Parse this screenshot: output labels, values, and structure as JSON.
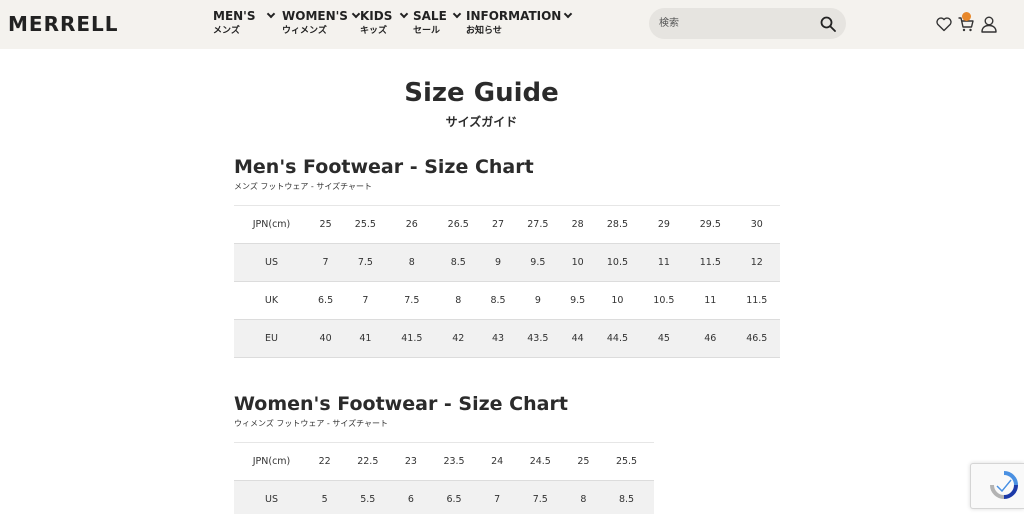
{
  "header": {
    "logo": "MERRELL",
    "nav": [
      {
        "en": "MEN'S",
        "ja": "メンズ"
      },
      {
        "en": "WOMEN'S",
        "ja": "ウィメンズ"
      },
      {
        "en": "KIDS",
        "ja": "キッズ"
      },
      {
        "en": "SALE",
        "ja": "セール"
      },
      {
        "en": "INFORMATION",
        "ja": "お知らせ"
      }
    ],
    "search_placeholder": "検索",
    "cart_count": "0"
  },
  "page": {
    "title": "Size Guide",
    "subtitle": "サイズガイド"
  },
  "mens": {
    "title": "Men's Footwear - Size Chart",
    "subtitle": "メンズ フットウェア - サイズチャート",
    "rows": [
      [
        "JPN(cm)",
        "25",
        "25.5",
        "26",
        "26.5",
        "27",
        "27.5",
        "28",
        "28.5",
        "29",
        "29.5",
        "30"
      ],
      [
        "US",
        "7",
        "7.5",
        "8",
        "8.5",
        "9",
        "9.5",
        "10",
        "10.5",
        "11",
        "11.5",
        "12"
      ],
      [
        "UK",
        "6.5",
        "7",
        "7.5",
        "8",
        "8.5",
        "9",
        "9.5",
        "10",
        "10.5",
        "11",
        "11.5"
      ],
      [
        "EU",
        "40",
        "41",
        "41.5",
        "42",
        "43",
        "43.5",
        "44",
        "44.5",
        "45",
        "46",
        "46.5"
      ]
    ]
  },
  "womens": {
    "title": "Women's Footwear - Size Chart",
    "subtitle": "ウィメンズ フットウェア - サイズチャート",
    "rows": [
      [
        "JPN(cm)",
        "22",
        "22.5",
        "23",
        "23.5",
        "24",
        "24.5",
        "25",
        "25.5"
      ],
      [
        "US",
        "5",
        "5.5",
        "6",
        "6.5",
        "7",
        "7.5",
        "8",
        "8.5"
      ]
    ]
  },
  "colors": {
    "header_bg": "#f4f2ee",
    "row_shade": "#f1f1f1",
    "badge": "#e8882a"
  },
  "icons": [
    "search-icon",
    "heart-icon",
    "cart-icon",
    "user-icon",
    "recaptcha-icon"
  ]
}
